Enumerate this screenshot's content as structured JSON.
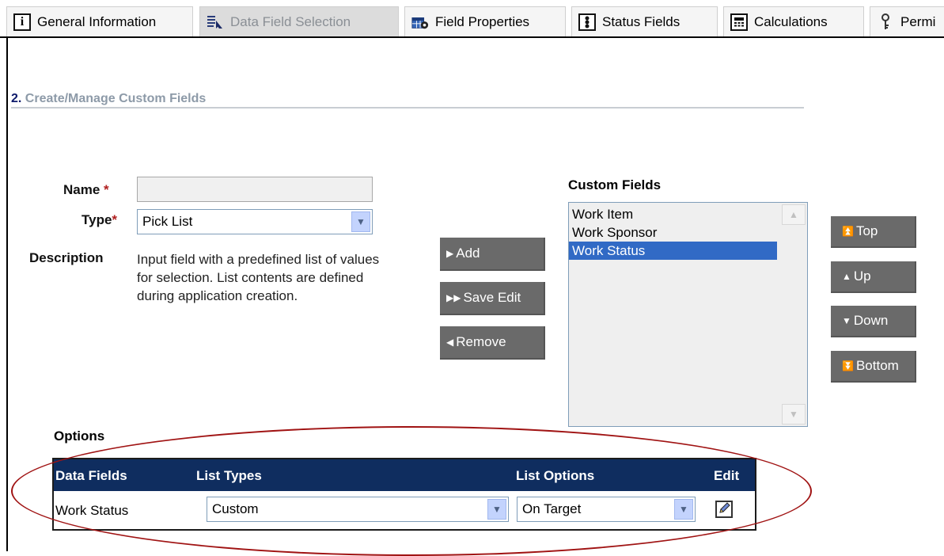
{
  "tabs": [
    {
      "label": "General Information",
      "icon": "info-icon"
    },
    {
      "label": "Data Field Selection",
      "icon": "field-select-icon"
    },
    {
      "label": "Field Properties",
      "icon": "field-properties-icon"
    },
    {
      "label": "Status Fields",
      "icon": "status-light-icon"
    },
    {
      "label": "Calculations",
      "icon": "calculator-icon"
    },
    {
      "label": "Permi",
      "icon": "key-icon"
    }
  ],
  "section": {
    "number": "2.",
    "title": "Create/Manage Custom Fields"
  },
  "form": {
    "name_label": "Name",
    "name_value": "",
    "type_label": "Type",
    "type_value": "Pick List",
    "description_label": "Description",
    "description_text": "Input field with a predefined list of values for selection. List contents are defined during application creation.",
    "required_mark": "*"
  },
  "actions": {
    "add": "Add",
    "save_edit": "Save Edit",
    "remove": "Remove"
  },
  "custom_fields": {
    "label": "Custom Fields",
    "items": [
      "Work Item",
      "Work Sponsor",
      "Work Status"
    ],
    "selected": "Work Status"
  },
  "order_buttons": {
    "top": "Top",
    "up": "Up",
    "down": "Down",
    "bottom": "Bottom"
  },
  "options": {
    "label": "Options",
    "columns": [
      "Data Fields",
      "List Types",
      "List Options",
      "Edit"
    ],
    "row": {
      "data_field": "Work Status",
      "list_type": "Custom",
      "list_option": "On Target"
    }
  },
  "colors": {
    "grid_header": "#0f2d5f",
    "selection": "#316ac5",
    "annotation": "#a01313",
    "button": "#6a6a6a"
  }
}
